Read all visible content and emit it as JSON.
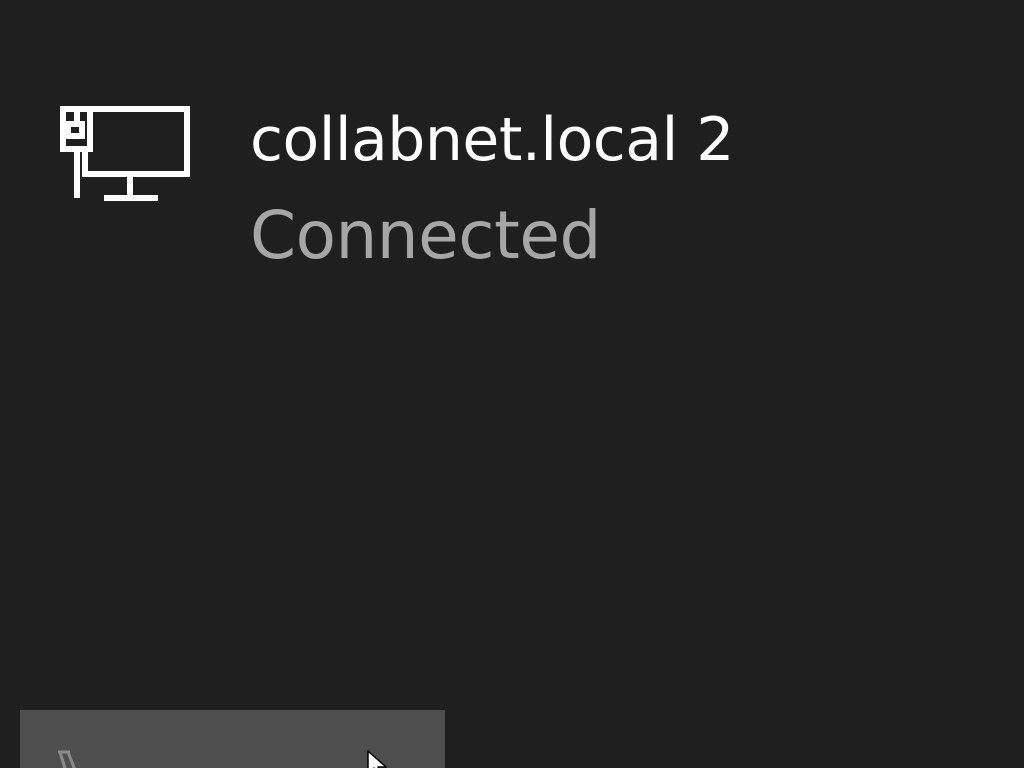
{
  "network": {
    "name": "collabnet.local 2",
    "status": "Connected",
    "icon": "wired-network-icon"
  },
  "colors": {
    "background": "#1f1f1f",
    "primary_text": "#ffffff",
    "secondary_text": "#a6a6a6",
    "tile_background": "#4e4e4e"
  },
  "tile": {
    "icon": "partial-glyph-icon"
  },
  "pointer": {
    "icon": "mouse-cursor-icon"
  }
}
